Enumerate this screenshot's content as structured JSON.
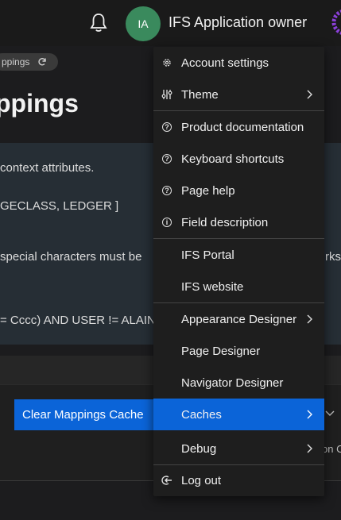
{
  "header": {
    "avatar_initials": "IA",
    "user_name": "IFS Application owner"
  },
  "page": {
    "breadcrumb": "ppings",
    "title": "ppings",
    "info_lines": [
      "context attributes.",
      "GECLASS, LEDGER ]",
      "special characters must be",
      "= Cccc) AND USER != ALAIN"
    ],
    "right_fragment_1": "rks",
    "right_fragment_2": "on C",
    "clear_cache_button": "Clear Mappings Cache"
  },
  "menu": {
    "items": [
      {
        "label": "Account settings",
        "icon": "gear-icon"
      },
      {
        "label": "Theme",
        "icon": "sliders-icon"
      },
      {
        "label": "Product documentation",
        "icon": "help-icon"
      },
      {
        "label": "Keyboard shortcuts",
        "icon": "help-icon"
      },
      {
        "label": "Page help",
        "icon": "help-icon"
      },
      {
        "label": "Field description",
        "icon": "info-icon"
      },
      {
        "label": "IFS Portal"
      },
      {
        "label": "IFS website"
      },
      {
        "label": "Appearance Designer"
      },
      {
        "label": "Page Designer"
      },
      {
        "label": "Navigator Designer"
      },
      {
        "label": "Caches"
      },
      {
        "label": "Debug"
      },
      {
        "label": "Log out",
        "icon": "logout-icon"
      }
    ]
  },
  "colors": {
    "accent": "#0b64d8",
    "avatar": "#3a8a5d",
    "menu_bg": "#1e1e1e"
  }
}
